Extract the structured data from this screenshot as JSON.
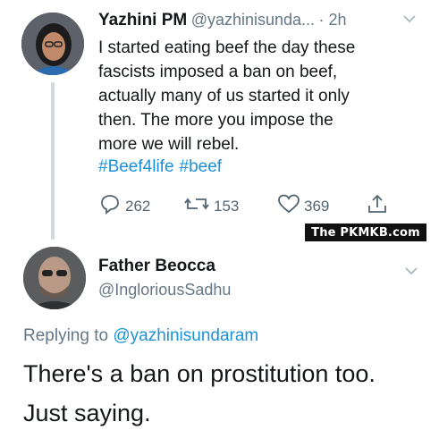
{
  "tweet1": {
    "name": "Yazhini PM",
    "handle": "@yazhinisunda...",
    "time": "· 2h",
    "lines": [
      "I started eating beef the day these",
      "fascists imposed a ban on beef,",
      "actually many of us started it only",
      "then. The more you impose the",
      "more we will rebel."
    ],
    "hashtags": [
      "#Beef4life",
      "#beef"
    ],
    "replies": "262",
    "retweets": "153",
    "likes": "369"
  },
  "watermark": "The PKMKB.com",
  "tweet2": {
    "name": "Father Beocca",
    "handle": "@IngloriousSadhu",
    "replying_prefix": "Replying to",
    "replying_to": "@yazhinisundaram",
    "lines": [
      "There's a ban on prostitution too.",
      "Just saying."
    ]
  },
  "icons": {
    "reply": "reply-icon",
    "retweet": "retweet-icon",
    "like": "heart-icon",
    "share": "share-icon",
    "menu": "chevron-down-icon"
  },
  "colors": {
    "link": "#1a91da",
    "muted": "#657786",
    "text": "#14171a"
  }
}
